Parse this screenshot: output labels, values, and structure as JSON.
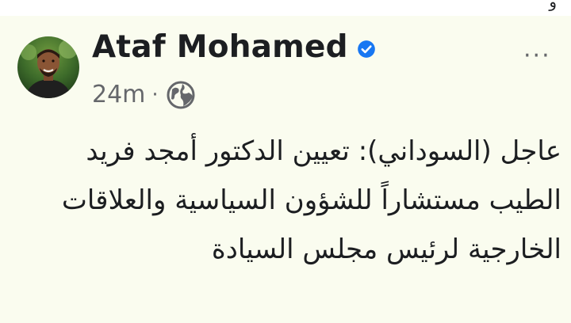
{
  "page": {
    "background": "#fafcef"
  },
  "top_fragment": "و",
  "post": {
    "author": {
      "name": "Ataf Mohamed",
      "verified": true
    },
    "timestamp": "24m",
    "separator": "·",
    "audience_icon": "globe-icon",
    "more_icon": "more-options-icon",
    "more_label": "···",
    "text": "عاجل (السوداني): تعيين الدكتور أمجد فريد الطيب مستشاراً للشؤون السياسية والعلاقات الخارجية لرئيس مجلس السيادة"
  },
  "colors": {
    "text_primary": "#1c1e21",
    "text_secondary": "#65676b",
    "verified_badge": "#1877f2"
  }
}
